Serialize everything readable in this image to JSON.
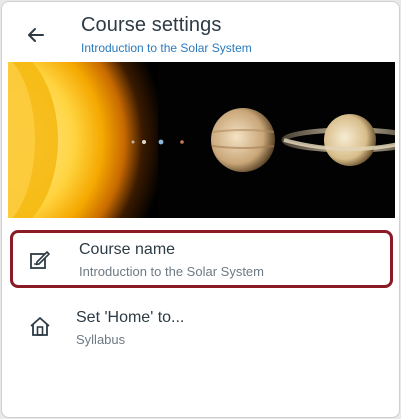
{
  "header": {
    "title": "Course settings",
    "subtitle": "Introduction to the Solar System"
  },
  "banner": {
    "image_subject": "solar system planets beside the sun"
  },
  "settings": [
    {
      "label": "Course name",
      "value": "Introduction to the Solar System",
      "icon": "edit-icon",
      "selected": true
    },
    {
      "label": "Set 'Home' to...",
      "value": "Syllabus",
      "icon": "home-icon",
      "selected": false
    }
  ],
  "colors": {
    "title": "#2d3b45",
    "subtitle_link": "#2a7abc",
    "selection_outline": "#8a1b24",
    "secondary_text": "#6e7a84"
  }
}
